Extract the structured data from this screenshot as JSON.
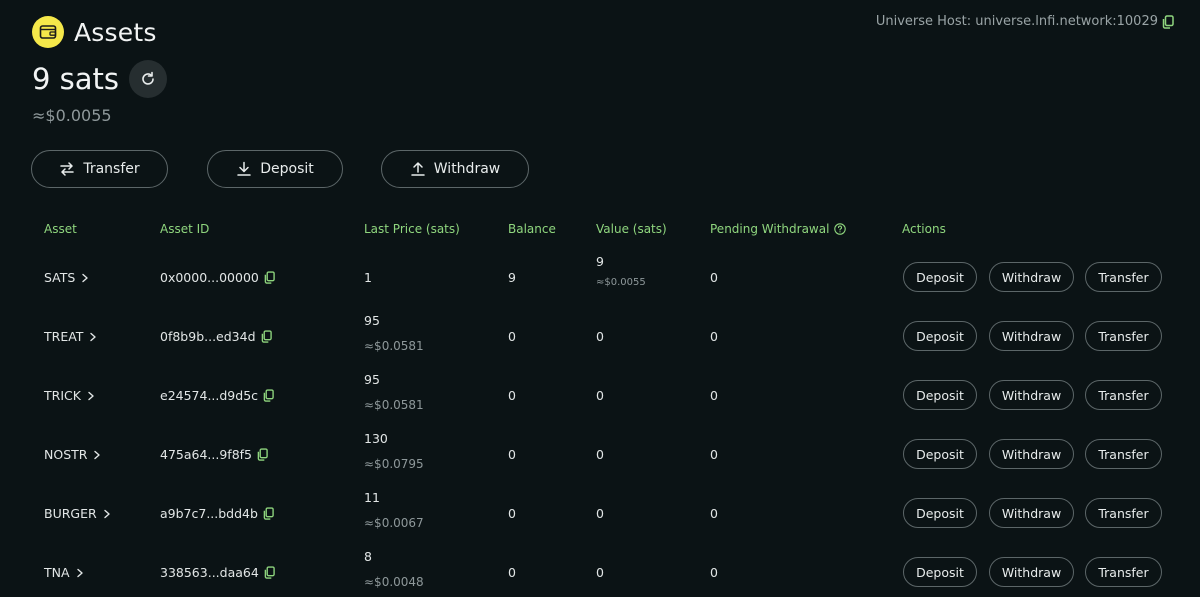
{
  "header": {
    "title": "Assets",
    "host_label": "Universe Host: universe.lnfi.network:10029"
  },
  "balance": {
    "amount": "9 sats",
    "usd": "≈$0.0055"
  },
  "actions": {
    "transfer": "Transfer",
    "deposit": "Deposit",
    "withdraw": "Withdraw"
  },
  "table": {
    "columns": [
      "Asset",
      "Asset ID",
      "Last Price (sats)",
      "Balance",
      "Value (sats)",
      "Pending Withdrawal",
      "Actions"
    ],
    "row_buttons": {
      "deposit": "Deposit",
      "withdraw": "Withdraw",
      "transfer": "Transfer"
    },
    "rows": [
      {
        "asset": "SATS",
        "asset_id": "0x0000...00000",
        "price": "1",
        "price_usd": "",
        "balance": "9",
        "value": "9",
        "value_usd": "≈$0.0055",
        "pending": "0"
      },
      {
        "asset": "TREAT",
        "asset_id": "0f8b9b...ed34d",
        "price": "95",
        "price_usd": "≈$0.0581",
        "balance": "0",
        "value": "0",
        "value_usd": "",
        "pending": "0"
      },
      {
        "asset": "TRICK",
        "asset_id": "e24574...d9d5c",
        "price": "95",
        "price_usd": "≈$0.0581",
        "balance": "0",
        "value": "0",
        "value_usd": "",
        "pending": "0"
      },
      {
        "asset": "NOSTR",
        "asset_id": "475a64...9f8f5",
        "price": "130",
        "price_usd": "≈$0.0795",
        "balance": "0",
        "value": "0",
        "value_usd": "",
        "pending": "0"
      },
      {
        "asset": "BURGER",
        "asset_id": "a9b7c7...bdd4b",
        "price": "11",
        "price_usd": "≈$0.0067",
        "balance": "0",
        "value": "0",
        "value_usd": "",
        "pending": "0"
      },
      {
        "asset": "TNA",
        "asset_id": "338563...daa64",
        "price": "8",
        "price_usd": "≈$0.0048",
        "balance": "0",
        "value": "0",
        "value_usd": "",
        "pending": "0"
      }
    ]
  },
  "icons": {
    "wallet": "wallet-icon",
    "refresh": "refresh-icon",
    "copy": "copy-icon",
    "transfer": "swap-arrows-icon",
    "deposit": "download-arrow-icon",
    "withdraw": "upload-arrow-icon",
    "help": "question-circle-icon",
    "chevron": "chevron-right-icon"
  },
  "colors": {
    "background": "#0b1315",
    "accent": "#f5e84a",
    "header_text": "#8fd67e",
    "copy_icon": "#8fd67e"
  }
}
